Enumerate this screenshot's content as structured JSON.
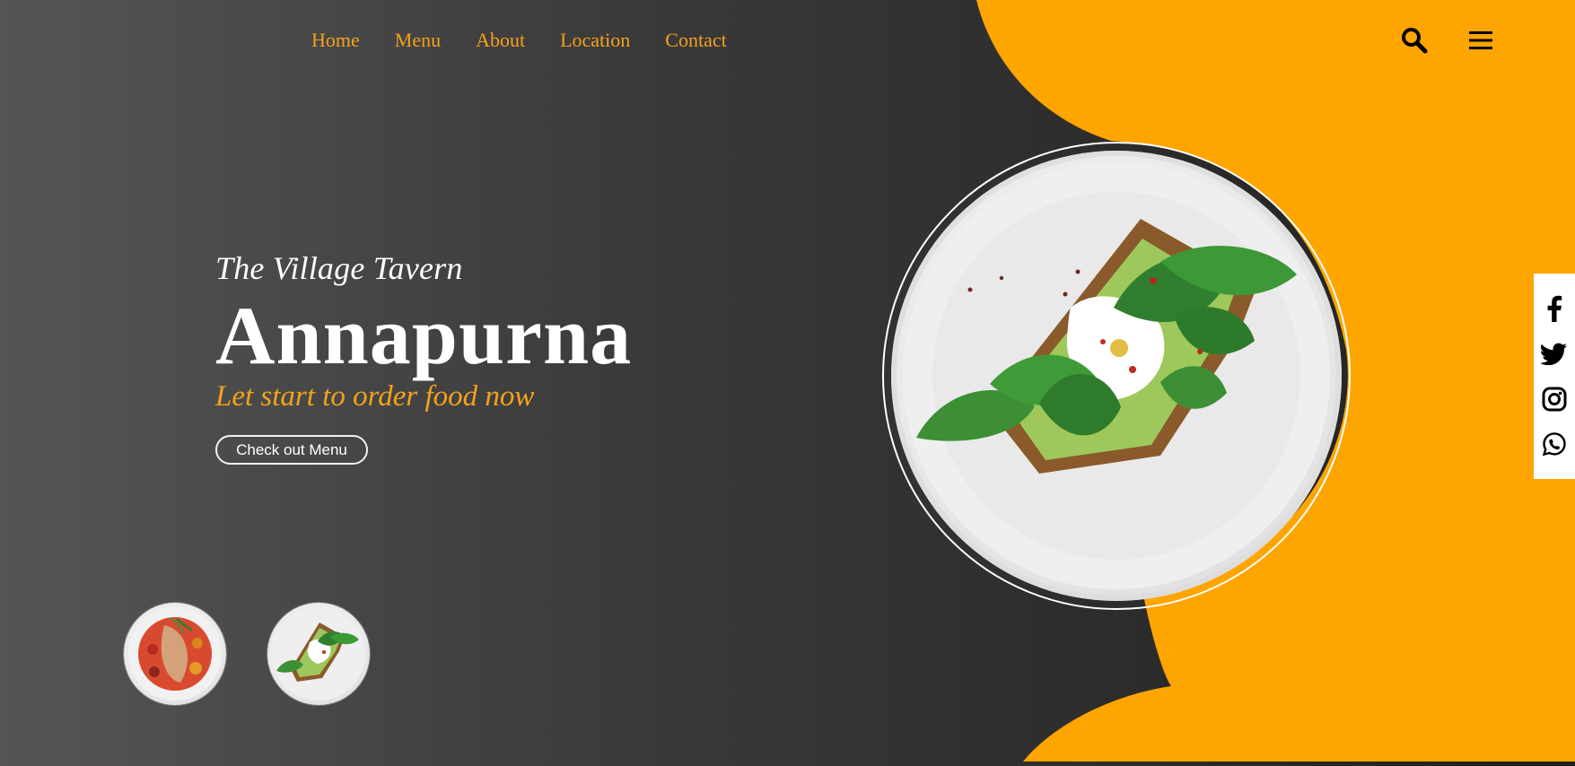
{
  "nav": {
    "items": [
      {
        "label": "Home"
      },
      {
        "label": "Menu"
      },
      {
        "label": "About"
      },
      {
        "label": "Location"
      },
      {
        "label": "Contact"
      }
    ]
  },
  "header_icons": {
    "search": "search-icon",
    "menu": "menu-icon"
  },
  "hero": {
    "subtitle": "The Village Tavern",
    "title": "Annapurna",
    "tagline": "Let start to order food now",
    "button_label": "Check out Menu"
  },
  "social": [
    {
      "name": "facebook-icon"
    },
    {
      "name": "twitter-icon"
    },
    {
      "name": "instagram-icon"
    },
    {
      "name": "whatsapp-icon"
    }
  ],
  "colors": {
    "accent": "#f5a21b",
    "orange_shape": "#ffa500",
    "dark_bg": "#1f1f1f",
    "text_light": "#ffffff"
  }
}
